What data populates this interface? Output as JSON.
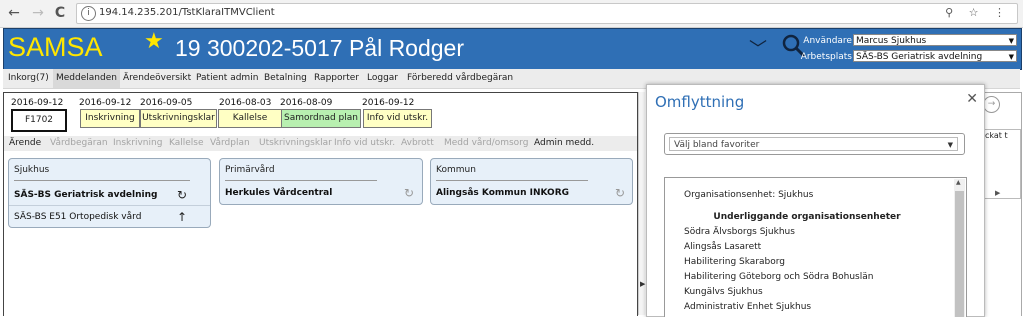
{
  "browser": {
    "url": "194.14.235.201/TstKlaraITMVClient",
    "back_glyph": "←",
    "forward_glyph": "→",
    "reload_glyph": "C",
    "info_glyph": "i",
    "right_icons": "⚲ ☆ ⋮"
  },
  "header": {
    "logo": "SAMSA",
    "star_glyph": "★",
    "patient": "19 300202-5017 Pål Rodger",
    "chevron_glyph": "﹀",
    "user_label": "Användare:",
    "user_value": "Marcus Sjukhus",
    "workplace_label": "Arbetsplats:",
    "workplace_value": "SÄS-BS Geriatrisk avdelning",
    "select_arrow": "▼"
  },
  "menu": [
    {
      "label": "Inkorg(7)"
    },
    {
      "label": "Meddelanden"
    },
    {
      "label": "Ärendeöversikt"
    },
    {
      "label": "Patient admin"
    },
    {
      "label": "Betalning"
    },
    {
      "label": "Rapporter"
    },
    {
      "label": "Loggar"
    },
    {
      "label": "Förberedd vårdbegäran"
    }
  ],
  "main": {
    "ref_date": "2016-09-12",
    "ref_code": "F1702",
    "statuses": [
      {
        "date": "2016-09-12",
        "label": "Inskrivning"
      },
      {
        "date": "2016-09-05",
        "label": "Utskrivningsklar"
      },
      {
        "date": "2016-08-03",
        "label": "Kallelse"
      },
      {
        "date": "2016-08-09",
        "label": "Samordnad plan"
      },
      {
        "date": "2016-09-12",
        "label": "Info vid utskr."
      }
    ],
    "tabs": [
      {
        "label": "Ärende"
      },
      {
        "label": "Vårdbegäran"
      },
      {
        "label": "Inskrivning"
      },
      {
        "label": "Kallelse"
      },
      {
        "label": "Vårdplan"
      },
      {
        "label": "Utskrivningsklar"
      },
      {
        "label": "Info vid utskr."
      },
      {
        "label": "Avbrott"
      },
      {
        "label": "Medd vård/omsorg"
      },
      {
        "label": "Admin medd."
      }
    ],
    "cards": [
      {
        "title": "Sjukhus",
        "rows": [
          "SÄS-BS Geriatrisk avdelning",
          "SÄS-BS E51 Ortopedisk vård"
        ]
      },
      {
        "title": "Primärvård",
        "rows": [
          "Herkules Vårdcentral"
        ]
      },
      {
        "title": "Kommun",
        "rows": [
          "Alingsås Kommun INKORG"
        ]
      }
    ],
    "icons": {
      "refresh": "↻",
      "up": "↑"
    }
  },
  "background_right": {
    "circle_glyph": "→",
    "column_header": "ckat t",
    "scroll_arrow": "▶"
  },
  "splitter_arrow": "▶",
  "modal": {
    "title": "Omflyttning",
    "close_glyph": "✕",
    "favorites_placeholder": "Välj bland favoriter",
    "favorites_arrow": "▼",
    "org_unit_label": "Organisationsenhet: Sjukhus",
    "sub_units_heading": "Underliggande organisationsenheter",
    "sub_units": [
      "Södra Älvsborgs Sjukhus",
      "Alingsås Lasarett",
      "Habilitering Skaraborg",
      "Habilitering Göteborg och Södra Bohuslän",
      "Kungälvs Sjukhus",
      "Administrativ Enhet Sjukhus"
    ],
    "scroll_up": "▲"
  }
}
